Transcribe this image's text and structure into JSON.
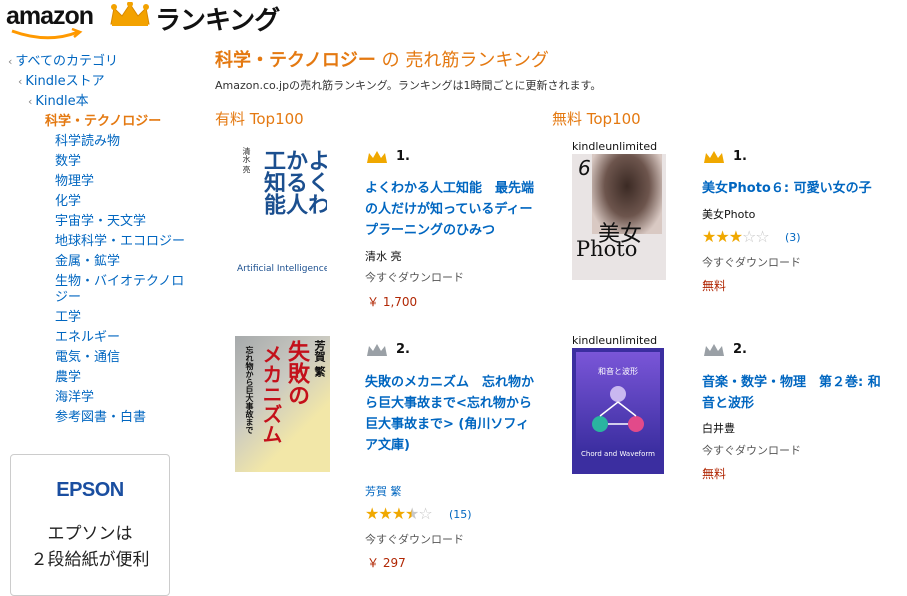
{
  "header": {
    "logo_text": "amazon",
    "ranking_text": "ランキング"
  },
  "sidebar": {
    "breadcrumbs": [
      {
        "label": "すべてのカテゴリ"
      },
      {
        "label": "Kindleストア"
      },
      {
        "label": "Kindle本"
      }
    ],
    "current": "科学・テクノロジー",
    "items": [
      {
        "label": "科学読み物"
      },
      {
        "label": "数学"
      },
      {
        "label": "物理学"
      },
      {
        "label": "化学"
      },
      {
        "label": "宇宙学・天文学"
      },
      {
        "label": "地球科学・エコロジー"
      },
      {
        "label": "金属・鉱学"
      },
      {
        "label": "生物・バイオテクノロジー"
      },
      {
        "label": "工学"
      },
      {
        "label": "エネルギー"
      },
      {
        "label": "電気・通信"
      },
      {
        "label": "農学"
      },
      {
        "label": "海洋学"
      },
      {
        "label": "参考図書・白書"
      }
    ]
  },
  "ad": {
    "brand": "EPSON",
    "line1": "エプソンは",
    "line2": "２段給紙が便利"
  },
  "main": {
    "title_keyword": "科学・テクノロジー",
    "title_rest": "の 売れ筋ランキング",
    "subtitle": "Amazon.co.jpの売れ筋ランキング。ランキングは1時間ごとに更新されます。",
    "paid_heading": "有料 Top100",
    "free_heading": "無料 Top100"
  },
  "paid": [
    {
      "rank": "1.",
      "title": "よくわかる人工知能　最先端の人だけが知っているディープラーニングのひみつ",
      "author": "清水 亮",
      "download": "今すぐダウンロード",
      "price": "￥ 1,700",
      "cover": {
        "author": "清水 亮",
        "title": "よくわかる人工知能",
        "english": "Artificial Intelligence"
      }
    },
    {
      "rank": "2.",
      "title": "失敗のメカニズム　忘れ物から巨大事故まで<忘れ物から巨大事故まで> (角川ソフィア文庫)",
      "author": "芳賀 繁",
      "rating": 3.5,
      "reviews": "15",
      "download": "今すぐダウンロード",
      "price": "￥ 297",
      "cover": {
        "author": "芳賀 繁",
        "title1": "失敗の",
        "title2": "メカニズム",
        "subtitle": "忘れ物から巨大事故まで"
      }
    }
  ],
  "free": [
    {
      "rank": "1.",
      "title": "美女Photo６: 可愛い女の子",
      "author": "美女Photo",
      "rating": 3,
      "reviews": "3",
      "download": "今すぐダウンロード",
      "price": "無料",
      "cover": {
        "badge": "kindleunlimited",
        "number": "6",
        "title1": "美女",
        "title2": "Photo"
      }
    },
    {
      "rank": "2.",
      "title": "音楽・数学・物理　第２巻: 和音と波形",
      "author": "白井豊",
      "download": "今すぐダウンロード",
      "price": "無料",
      "cover": {
        "badge": "kindleunlimited",
        "title": "和音と波形",
        "english1": "Chord and Waveform"
      }
    }
  ],
  "colors": {
    "accent": "#e47911",
    "link": "#0066c0",
    "price": "#b12704",
    "gold": "#f0a800",
    "silver": "#9aa0a6"
  }
}
